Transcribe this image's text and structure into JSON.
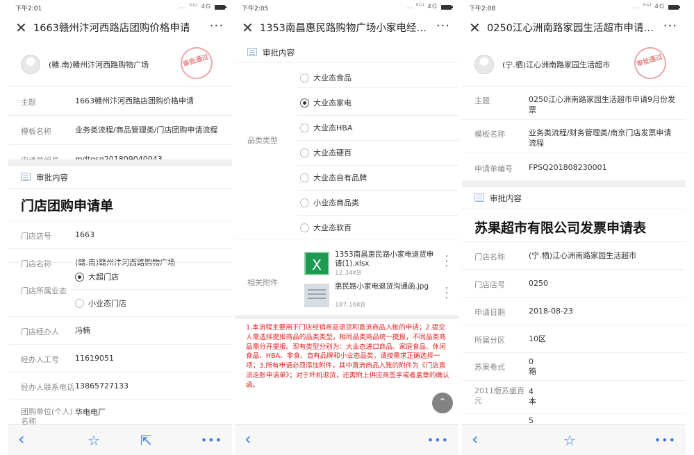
{
  "colors": {
    "accent": "#3d7ae2",
    "notice": "#e02020",
    "stamp": "#e07070"
  },
  "status_signal": "... ⁵ᴳᴵ 4G",
  "bottom_icons": {
    "back": "back-icon",
    "star": "star-icon",
    "share": "share-icon",
    "more": "more-dots-icon"
  },
  "screen1": {
    "time": "下午2:01",
    "title": "1663赣州汴河西路店团购价格申请",
    "applicant": "(赣.南)赣州汴河西路购物广场",
    "stamp": "审批通过",
    "fields": [
      {
        "label": "主题",
        "value": "1663赣州汴河西路店团购价格申请"
      },
      {
        "label": "模板名称",
        "value": "业务类流程/商品管理类/门店团购申请流程"
      },
      {
        "label": "申请单编号",
        "value": "mdtgsq201809040043"
      }
    ],
    "section_label": "审批内容",
    "form_title": "门店团购申请单",
    "form_fields": [
      {
        "label": "门店店号",
        "value": "1663"
      },
      {
        "label": "门店名称",
        "value": "(赣.南)赣州汴河西路购物广场"
      }
    ],
    "business_type_label": "门店所属业态",
    "business_type_options": [
      "大超门店",
      "小业态门店"
    ],
    "form_fields2": [
      {
        "label": "门店经办人",
        "value": "冯楠"
      },
      {
        "label": "经办人工号",
        "value": "11619051"
      },
      {
        "label": "经办人联系电话",
        "value": "13865727133"
      }
    ],
    "group_label": "团购单位(个人)名称",
    "group_value": "华电电厂"
  },
  "screen2": {
    "time": "下午2:05",
    "title": "1353南昌惠民路购物广场小家电经销...",
    "section_label": "审批内容",
    "category_label": "品类类型",
    "categories": [
      "大业态食品",
      "大业态家电",
      "大业态HBA",
      "大业态硬百",
      "大业态自有品牌",
      "小业态商品类",
      "大业态软百"
    ],
    "attachments_label": "相关附件",
    "attachments": [
      {
        "name": "1353南昌惠民路小家电退货申请(1).xlsx",
        "size": "12.34KB",
        "icon": "excel-file-icon"
      },
      {
        "name": "惠民路小家电退货沟通函.jpg",
        "size": "187.16KB",
        "icon": "image-file-icon"
      }
    ],
    "notice": "1.本流程主要用于门店经销商品退货和直流商品入帐的申请；2.提交人需选择提报商品的品类类型，相同品类商品统一提报，不同品类商品需分开提报。现有类型分别为：大业态进口商品、家庭食品、休闲食品、HBA、非食、自有品牌和小业态品类，请按需求正确选择一项；3.所有申请必须添加附件，其中直流商品入账的附件为《门店直流走账申请单》；对于坏机退货，还需附上供应商签字或者盖章的确认函。"
  },
  "screen3": {
    "time": "下午2:08",
    "title": "0250江心洲南路家园生活超市申请9...",
    "applicant": "(宁.栖)江心洲南路家园生活超市",
    "stamp": "审批通过",
    "fields": [
      {
        "label": "主题",
        "value": "0250江心洲南路家园生活超市申请9月份发票"
      },
      {
        "label": "模板名称",
        "value": "业务类流程/财务管理类/南京门店发票申请流程"
      },
      {
        "label": "申请单编号",
        "value": "FPSQ201808230001"
      }
    ],
    "section_label": "审批内容",
    "form_title": "苏果超市有限公司发票申请表",
    "form_fields": [
      {
        "label": "门店名称",
        "value": "(宁.栖)江心洲南路家园生活超市"
      },
      {
        "label": "门店店号",
        "value": "0250"
      },
      {
        "label": "申请日期",
        "value": "2018-08-23"
      },
      {
        "label": "所属分区",
        "value": "10区"
      }
    ],
    "quantities": [
      {
        "label": "苏果卷式",
        "value": "0",
        "unit": "箱"
      },
      {
        "label": "2011版苏盛百元",
        "value": "4",
        "unit": "本"
      }
    ],
    "partial_value": "5"
  }
}
